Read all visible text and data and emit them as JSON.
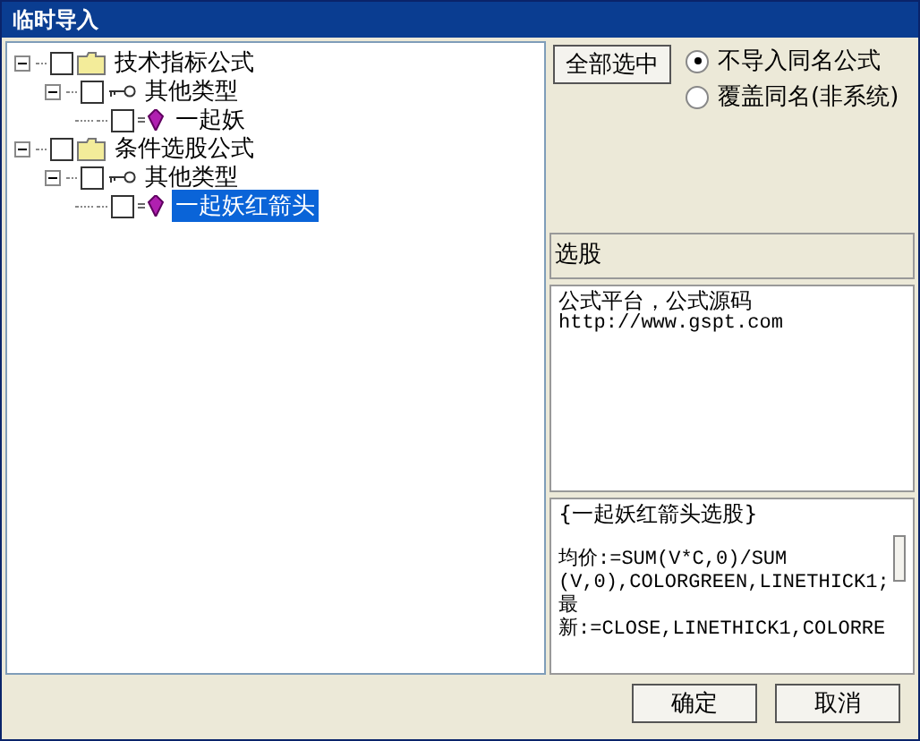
{
  "window": {
    "title": "临时导入"
  },
  "tree": [
    {
      "kind": "folder",
      "label": "技术指标公式",
      "checked": false,
      "expanded": true,
      "selected": false,
      "children": [
        {
          "kind": "type",
          "label": "其他类型",
          "checked": false,
          "expanded": true,
          "selected": false,
          "children": [
            {
              "kind": "formula",
              "label": "一起妖",
              "checked": false,
              "selected": false
            }
          ]
        }
      ]
    },
    {
      "kind": "folder",
      "label": "条件选股公式",
      "checked": false,
      "expanded": true,
      "selected": false,
      "children": [
        {
          "kind": "type",
          "label": "其他类型",
          "checked": false,
          "expanded": true,
          "selected": false,
          "children": [
            {
              "kind": "formula",
              "label": "一起妖红箭头",
              "checked": false,
              "selected": true
            }
          ]
        }
      ]
    }
  ],
  "select_all_button": "全部选中",
  "options": [
    {
      "label": "不导入同名公式",
      "selected": true
    },
    {
      "label": "覆盖同名(非系统)",
      "selected": false
    }
  ],
  "category_field": {
    "value": "选股"
  },
  "description": [
    "公式平台，公式源码",
    "http://www.gspt.com"
  ],
  "source": [
    "{一起妖红箭头选股}",
    "均价:=SUM(V*C,0)/SUM",
    "(V,0),COLORGREEN,LINETHICK1;",
    "最",
    "新:=CLOSE,LINETHICK1,COLORRE"
  ],
  "buttons": [
    "确定",
    "取消"
  ]
}
